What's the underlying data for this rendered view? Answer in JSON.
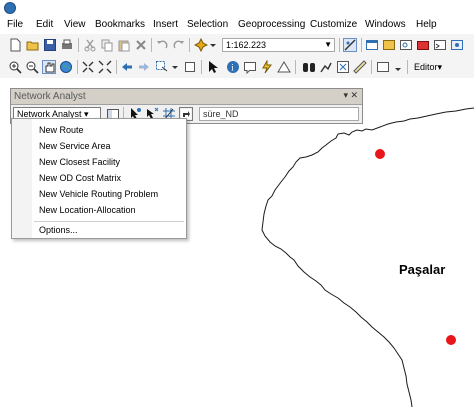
{
  "menubar": {
    "items": [
      "File",
      "Edit",
      "View",
      "Bookmarks",
      "Insert",
      "Selection",
      "Geoprocessing",
      "Customize",
      "Windows",
      "Help"
    ]
  },
  "toolbar": {
    "scale_value": "1:162.223",
    "editor_label": "Editor▾"
  },
  "network_analyst": {
    "window_title": "Network Analyst",
    "dropdown_label": "Network Analyst ▾",
    "dataset_value": "süre_ND",
    "menu_items": [
      "New Route",
      "New Service Area",
      "New Closest Facility",
      "New OD Cost Matrix",
      "New Vehicle Routing Problem",
      "New Location-Allocation"
    ],
    "options_label": "Options..."
  },
  "map": {
    "place_label": "Paşalar",
    "point_color": "#e8161b",
    "boundary_color": "#1a1a1a"
  },
  "colors": {
    "toolbar_bg": "#f4f4f4",
    "title_bg": "#d4d0c8",
    "accent": "#2f6fb3"
  }
}
